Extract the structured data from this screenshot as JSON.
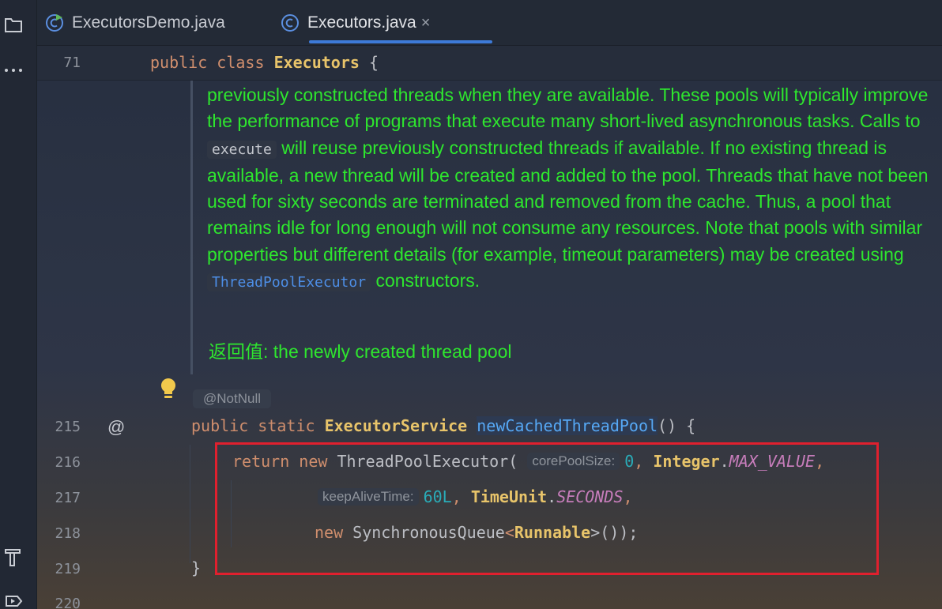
{
  "tabs": [
    {
      "label": "ExecutorsDemo.java",
      "icon": "java-class-run-icon",
      "active": false
    },
    {
      "label": "Executors.java",
      "icon": "java-class-icon",
      "active": true,
      "close": "×"
    }
  ],
  "sticky": {
    "line_number": "71",
    "kw1": "public",
    "kw2": "class",
    "class_name": "Executors",
    "brace": "{"
  },
  "doc": {
    "p1": "previously constructed threads when they are available. These pools will typically improve the performance of programs that execute many short-lived asynchronous tasks. Calls to",
    "code_execute": "execute",
    "p2": "will reuse previously constructed threads if available. If no existing thread is available, a new thread will be created and added to the pool. Threads that have not been used for sixty seconds are terminated and removed from the cache. Thus, a pool that remains idle for long enough will not consume any resources. Note that pools with similar properties but different details (for example, timeout parameters) may be created using",
    "code_tpe": "ThreadPoolExecutor",
    "p3": "constructors.",
    "return_label": "返回值:",
    "return_text": "the newly created thread pool"
  },
  "annotation": "@NotNull",
  "lines": {
    "l215": {
      "num": "215",
      "kw1": "public",
      "kw2": "static",
      "type": "ExecutorService",
      "method": "newCachedThreadPool",
      "rest": "() {"
    },
    "l216": {
      "num": "216",
      "kw": "return",
      "kw2": "new",
      "cls": "ThreadPoolExecutor",
      "open": "(",
      "hint": "corePoolSize:",
      "n": "0",
      "comma": ",",
      "type": "Integer",
      "dot": ".",
      "field": "MAX_VALUE",
      "end": ","
    },
    "l217": {
      "num": "217",
      "hint": "keepAliveTime:",
      "n": "60L",
      "comma": ",",
      "type": "TimeUnit",
      "dot": ".",
      "field": "SECONDS",
      "end": ","
    },
    "l218": {
      "num": "218",
      "kw": "new",
      "cls": "SynchronousQueue",
      "lt": "<",
      "gen": "Runnable",
      "rest": ">());"
    },
    "l219": {
      "num": "219",
      "brace": "}"
    },
    "l220": {
      "num": "220"
    }
  }
}
